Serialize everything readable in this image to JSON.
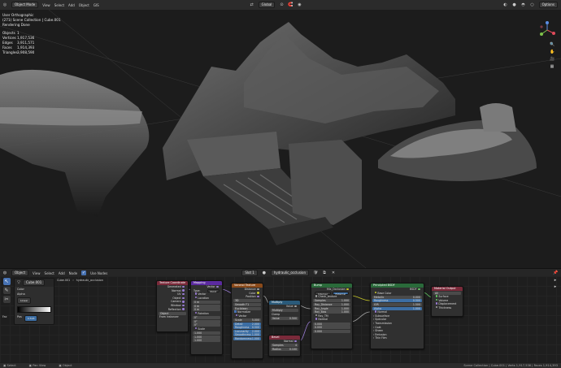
{
  "viewport_header": {
    "mode": "Object Mode",
    "menus": [
      "View",
      "Select",
      "Add",
      "Object",
      "GIS"
    ],
    "orientation": "Global",
    "options": "Options"
  },
  "viewport_overlay": {
    "view_name": "User Orthographic",
    "collection": "(271) Scene Collection | Cube.001",
    "render_state": "Rendering Done",
    "stats": [
      {
        "key": "Objects",
        "value": "1"
      },
      {
        "key": "Vertices",
        "value": "1,917,536"
      },
      {
        "key": "Edges",
        "value": "3,911,571"
      },
      {
        "key": "Faces",
        "value": "1,914,393"
      },
      {
        "key": "Triangles",
        "value": "3,908,590"
      }
    ]
  },
  "node_header": {
    "mode": "Object",
    "menus": [
      "View",
      "Select",
      "Add",
      "Node"
    ],
    "use_nodes": "Use Nodes",
    "slot": "Slot 1",
    "material": "hydraulic_occlusion"
  },
  "breadcrumb": {
    "object": "Cube.001",
    "material": "hydraulic_occlusion"
  },
  "side_panel": {
    "object": "Cube.001",
    "color_label": "Color",
    "alpha_label": "Alpha",
    "mode_label": "Linear",
    "pos_label": "Pos",
    "pos_value": "0.518",
    "tab": "Fac"
  },
  "nodes": {
    "texcoord": {
      "title": "Texture Coordinate",
      "outputs": [
        "Generated",
        "Normal",
        "UV",
        "Object",
        "Camera",
        "Window",
        "Reflection"
      ],
      "object_label": "Object",
      "from_instancer": "From Instancer"
    },
    "mapping": {
      "title": "Mapping",
      "type_label": "Type:",
      "type_value": "Point",
      "output": "Vector",
      "inputs": [
        "Vector",
        "Location",
        "Rotation",
        "Scale"
      ],
      "location": [
        "0 m",
        "0 m",
        "0 m"
      ],
      "rotation": [
        "0°",
        "0°",
        "0°"
      ],
      "scale": [
        "1.000",
        "1.000",
        "1.000"
      ]
    },
    "voronoi": {
      "title": "Voronoi Texture",
      "outputs": [
        "Distance",
        "Color",
        "Position"
      ],
      "dim": "3D",
      "feature": "Smooth F1",
      "metric": "Euclidean",
      "normalize": "Normalize",
      "inputs": [
        "Vector",
        "Scale",
        "Detail",
        "Roughness",
        "Lacunarity",
        "Smoothness",
        "Randomness"
      ],
      "values": [
        "5.000",
        "2.000",
        "0.500",
        "2.000",
        "1.000",
        "1.000"
      ]
    },
    "multiply": {
      "title": "Multiply",
      "output": "Value",
      "op": "Multiply",
      "clamp": "Clamp",
      "value_label": "Value",
      "value": "0.500"
    },
    "bevel": {
      "title": "Bevel",
      "output": "Normal",
      "samples_label": "Samples",
      "samples": "4",
      "radius_label": "Radius",
      "radius": "0.100"
    },
    "bump": {
      "title": "Bump",
      "output": "Mix_Occlusion",
      "tab1": "Internal",
      "tab2": "External",
      "outputs": [
        "Check_texture",
        "Samples",
        "Ray_Distance",
        "Ray_Angle",
        "Ray_Bias"
      ],
      "values": [
        "1.000",
        "1.000",
        "1.000",
        "1.000"
      ],
      "extra": [
        "Ray_TM",
        "Normal"
      ],
      "bottom_values": [
        "0.000",
        "0.000",
        "0.000"
      ]
    },
    "bsdf": {
      "title": "Principled BSDF",
      "output": "BSDF",
      "rows": [
        "Base Color",
        "Metallic",
        "Roughness",
        "IOR",
        "Alpha",
        "Normal",
        "Subsurface",
        "Specular",
        "Transmission",
        "Coat",
        "Sheen",
        "Emission",
        "Thin Film"
      ],
      "values": [
        "0.000",
        "0.500",
        "1.500",
        "1.000"
      ]
    },
    "output": {
      "title": "Material Output",
      "target": "All",
      "inputs": [
        "Surface",
        "Volume",
        "Displacement",
        "Thickness"
      ]
    }
  },
  "status_bar": {
    "left_items": [
      "Select",
      "Pan View",
      "Object"
    ],
    "right": "Scene Collection | Cube.001 | Verts 1,917,536 | Faces 1,914,393"
  }
}
